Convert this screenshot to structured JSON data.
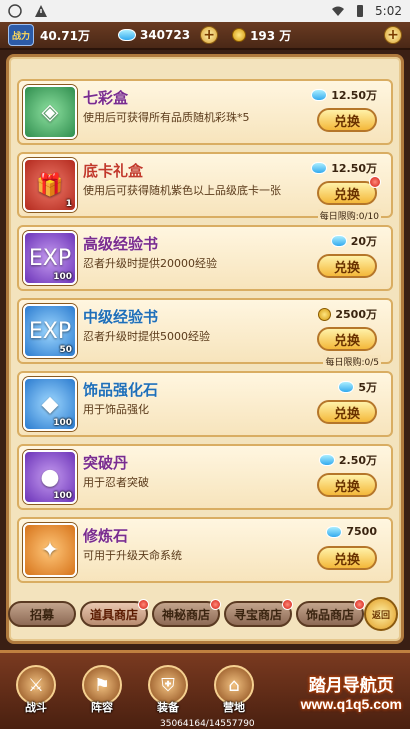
{
  "status_bar": {
    "time": "5:02"
  },
  "top_bar": {
    "power_label": "战力",
    "power_value": "40.71万",
    "diamonds": "340723",
    "coins": "193 万"
  },
  "items": [
    {
      "name": "七彩盒",
      "desc": "使用后可获得所有品质随机彩珠*5",
      "price": "12.50万",
      "currency": "diamond",
      "qty": "",
      "button": "兑换",
      "limit": "",
      "reddot": false,
      "thumb": "green",
      "name_color": "purple",
      "glyph": "◈"
    },
    {
      "name": "底卡礼盒",
      "desc": "使用后可获得随机紫色以上品级底卡一张",
      "price": "12.50万",
      "currency": "diamond",
      "qty": "1",
      "button": "兑换",
      "limit": "每日限购:0/10",
      "reddot": true,
      "thumb": "red",
      "name_color": "red",
      "glyph": "🎁"
    },
    {
      "name": "高级经验书",
      "desc": "忍者升级时提供20000经验",
      "price": "20万",
      "currency": "diamond",
      "qty": "100",
      "button": "兑换",
      "limit": "",
      "reddot": false,
      "thumb": "purple",
      "name_color": "purple",
      "glyph": "EXP"
    },
    {
      "name": "中级经验书",
      "desc": "忍者升级时提供5000经验",
      "price": "2500万",
      "currency": "coin",
      "qty": "50",
      "button": "兑换",
      "limit": "每日限购:0/5",
      "reddot": false,
      "thumb": "blue",
      "name_color": "blue",
      "glyph": "EXP"
    },
    {
      "name": "饰品强化石",
      "desc": "用于饰品强化",
      "price": "5万",
      "currency": "diamond",
      "qty": "100",
      "button": "兑换",
      "limit": "",
      "reddot": false,
      "thumb": "blue",
      "name_color": "blue",
      "glyph": "◆"
    },
    {
      "name": "突破丹",
      "desc": "用于忍者突破",
      "price": "2.50万",
      "currency": "diamond",
      "qty": "100",
      "button": "兑换",
      "limit": "",
      "reddot": false,
      "thumb": "purple",
      "name_color": "purple",
      "glyph": "●"
    },
    {
      "name": "修炼石",
      "desc": "可用于升级天命系统",
      "price": "7500",
      "currency": "diamond",
      "qty": "",
      "button": "兑换",
      "limit": "",
      "reddot": false,
      "thumb": "orange",
      "name_color": "purple",
      "glyph": "✦"
    }
  ],
  "tabs": [
    "招募",
    "道具商店",
    "神秘商店",
    "寻宝商店",
    "饰品商店"
  ],
  "back_label": "返回",
  "bottom_nav": [
    "战斗",
    "阵容",
    "装备",
    "营地"
  ],
  "watermark": {
    "line1": "踏月导航页",
    "line2": "www.q1q5.com"
  },
  "coords_text": "35064164/14557790"
}
